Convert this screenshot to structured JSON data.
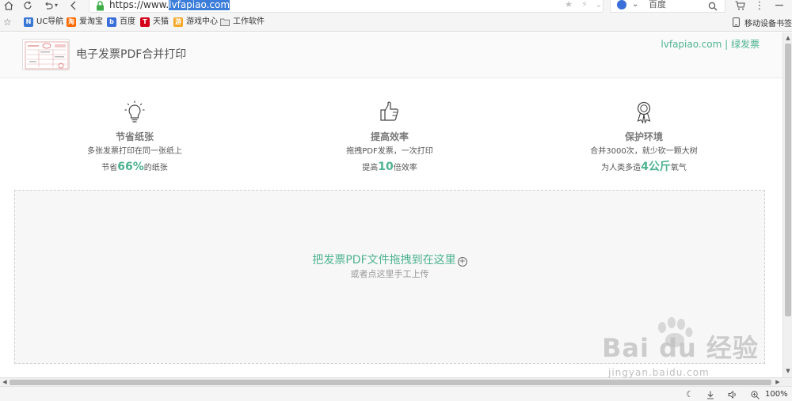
{
  "browser": {
    "url_prefix": "https://www.",
    "url_selected": "lvfapiao.com",
    "search_engine": "百度",
    "mobile_bookmarks": "移动设备书签",
    "zoom": "100%"
  },
  "bookmarks": [
    {
      "label": "UC导航",
      "color": "#3a78d6",
      "glyph": "N"
    },
    {
      "label": "爱淘宝",
      "color": "#ff6a00",
      "glyph": "淘"
    },
    {
      "label": "百度",
      "color": "#3a6fd9",
      "glyph": "b"
    },
    {
      "label": "天猫",
      "color": "#d4001a",
      "glyph": "T"
    },
    {
      "label": "游戏中心",
      "color": "#f5a623",
      "glyph": "游"
    },
    {
      "label": "工作软件",
      "color": "#8a8a8a",
      "glyph": ""
    }
  ],
  "header": {
    "title": "电子发票PDF合并打印",
    "brand": "lvfapiao.com | 绿发票"
  },
  "features": [
    {
      "icon": "lightbulb-icon",
      "title": "节省纸张",
      "line1": "多张发票打印在同一张纸上",
      "line2_pre": "节省",
      "line2_hl": "66%",
      "line2_post": "的纸张"
    },
    {
      "icon": "thumbs-up-icon",
      "title": "提高效率",
      "line1": "拖拽PDF发票，一次打印",
      "line2_pre": "提高",
      "line2_hl": "10",
      "line2_post": "倍效率"
    },
    {
      "icon": "award-ribbon-icon",
      "title": "保护环境",
      "line1": "合并3000次，就少砍一颗大树",
      "line2_pre": "为人类多造",
      "line2_hl": "4公斤",
      "line2_post": "氧气"
    }
  ],
  "dropzone": {
    "main": "把发票PDF文件拖拽到在这里",
    "plus": "+",
    "sub": "或者点这里手工上传"
  },
  "watermark": {
    "text": "Bai du 经验",
    "sub": "jingyan.baidu.com"
  },
  "colors": {
    "accent": "#4db391",
    "selection": "#3b7dd8"
  }
}
